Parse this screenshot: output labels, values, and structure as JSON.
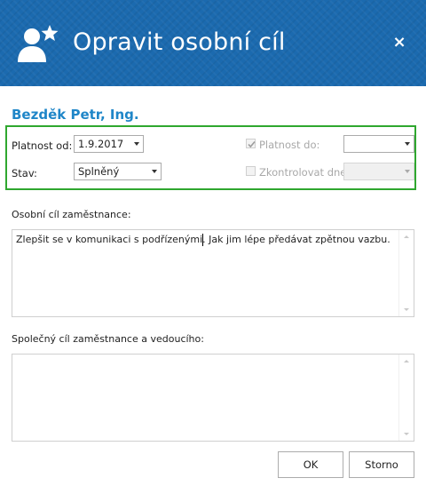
{
  "dialog": {
    "title": "Opravit osobní cíl",
    "close_label": "×",
    "header_color": "#1b6aaf",
    "icon": "user-star-icon"
  },
  "employee": {
    "name": "Bezděk Petr, Ing."
  },
  "validity": {
    "valid_from_label": "Platnost od:",
    "valid_from_value": "1.9.2017",
    "state_label": "Stav:",
    "state_value": "Splněný",
    "valid_to_label": "Platnost do:",
    "valid_to_checked": true,
    "valid_to_value": "",
    "check_date_label": "Zkontrolovat dne",
    "check_date_checked": false,
    "check_date_value": "",
    "highlight_color": "#2fa72f"
  },
  "personal_goal": {
    "label": "Osobní cíl zaměstnance:",
    "text": "Zlepšit se v komunikaci s podřízenými. Jak jim lépe předávat zpětnou vazbu."
  },
  "shared_goal": {
    "label": "Společný cíl zaměstnance a vedoucího:",
    "text": ""
  },
  "buttons": {
    "ok": "OK",
    "cancel": "Storno"
  }
}
